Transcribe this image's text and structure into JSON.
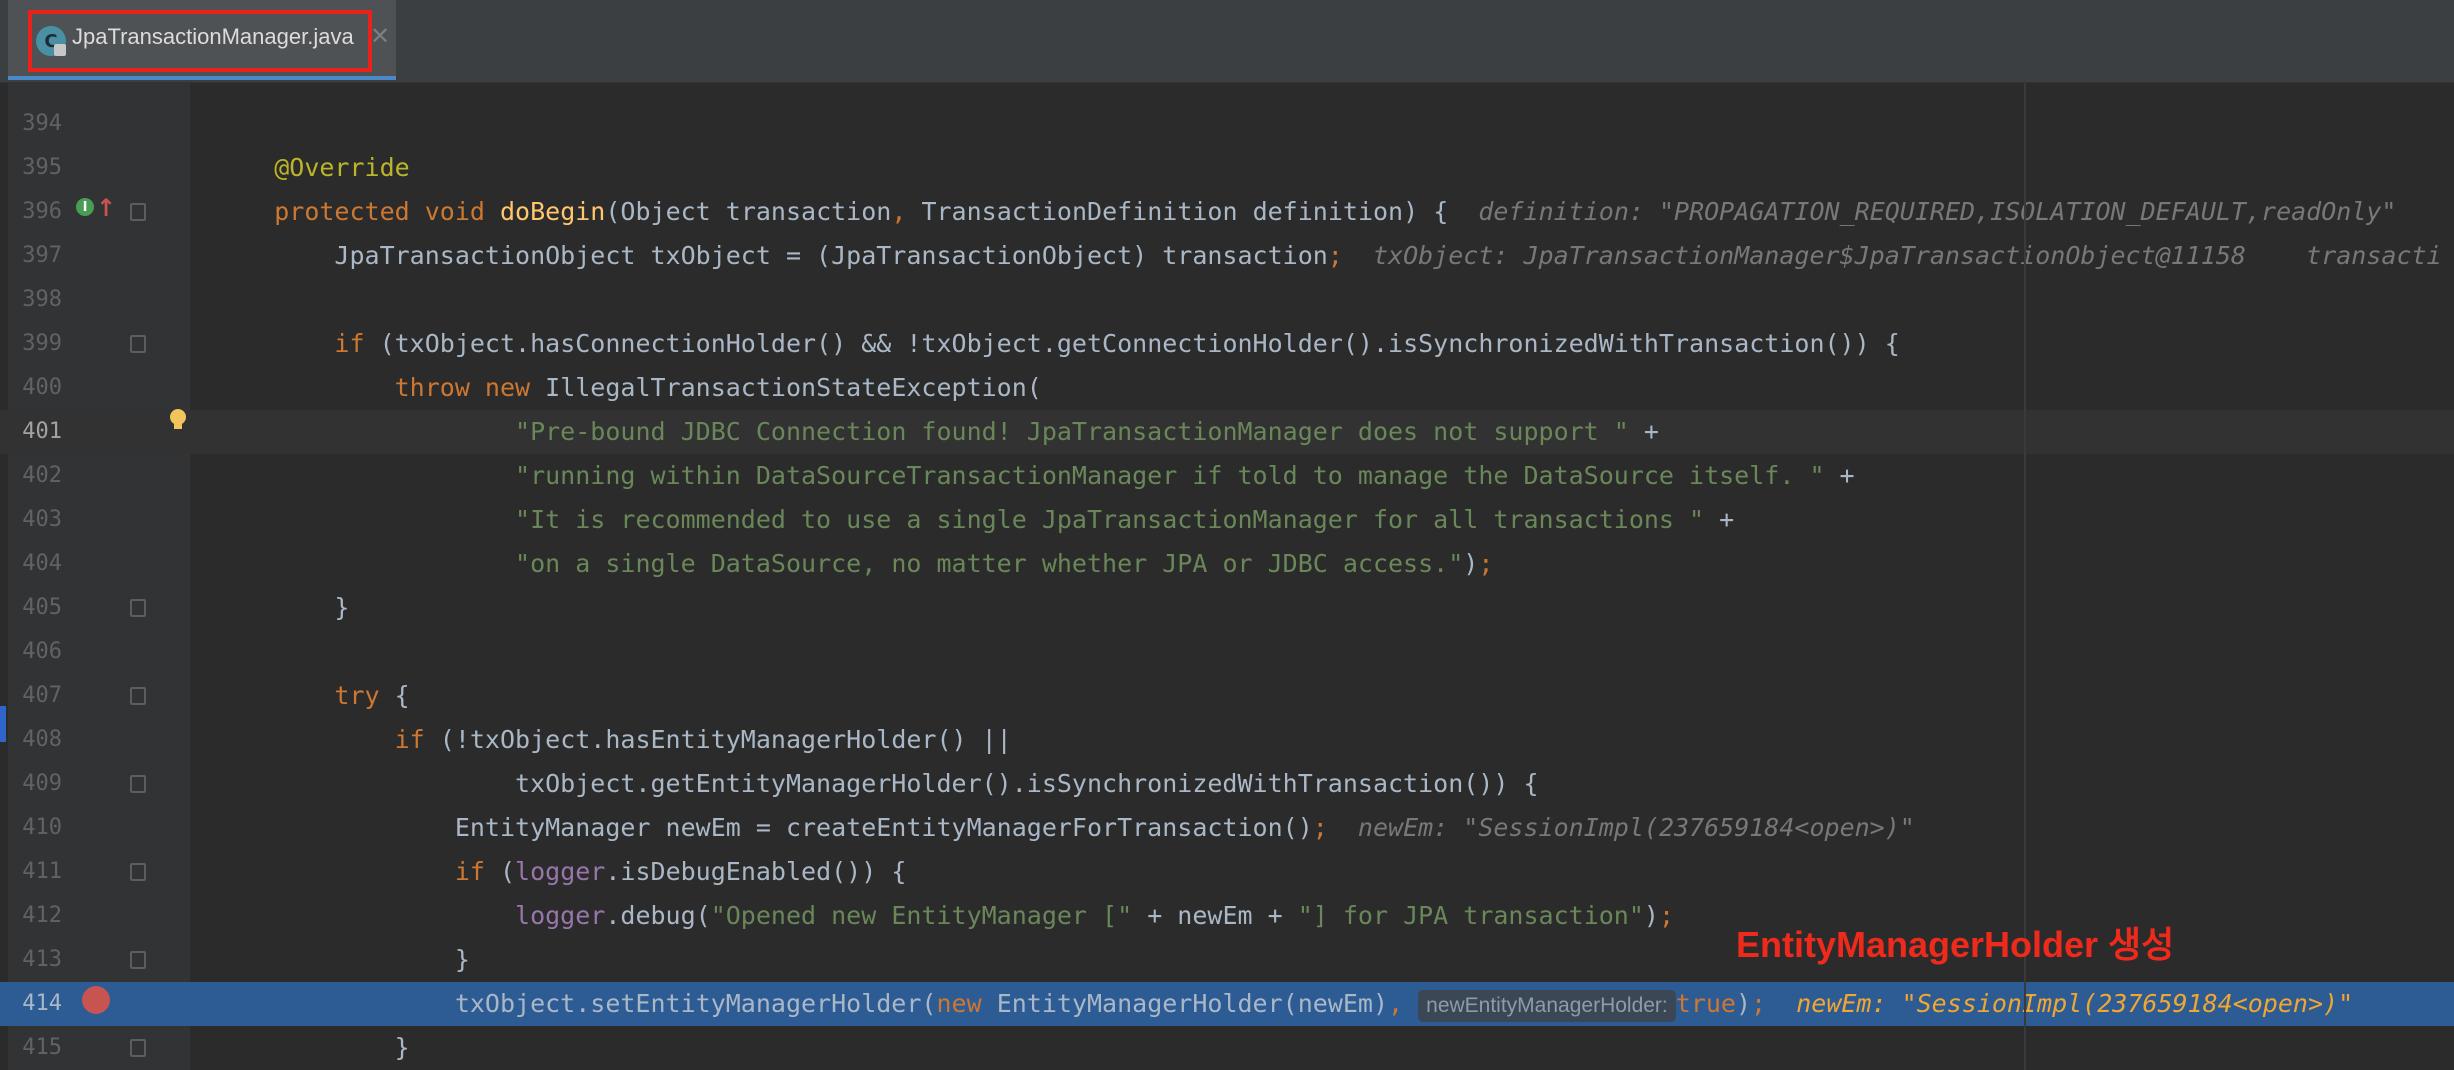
{
  "tab": {
    "icon_letter": "C",
    "filename": "JpaTransactionManager.java",
    "close_glyph": "✕"
  },
  "annotation": "EntityManagerHolder 생성",
  "colors": {
    "keyword": "#cc7832",
    "string": "#6a8759",
    "annotation": "#bbb529",
    "method": "#ffc66d",
    "breakpoint_line": "#2d5b94",
    "callout": "#ee2a1c"
  },
  "lines": [
    {
      "n": "394",
      "parts": []
    },
    {
      "n": "395",
      "parts": [
        {
          "t": "    "
        },
        {
          "t": "@Override",
          "c": "ann"
        }
      ]
    },
    {
      "n": "396",
      "parts": [
        {
          "t": "    "
        },
        {
          "t": "protected void ",
          "c": "kw"
        },
        {
          "t": "doBegin",
          "c": "fn"
        },
        {
          "t": "(Object transaction"
        },
        {
          "t": ", ",
          "c": "kw"
        },
        {
          "t": "TransactionDefinition definition) {  "
        },
        {
          "t": "definition: \"PROPAGATION_REQUIRED,ISOLATION_DEFAULT,readOnly\"",
          "c": "hint"
        }
      ]
    },
    {
      "n": "397",
      "parts": [
        {
          "t": "        JpaTransactionObject txObject = (JpaTransactionObject) transaction"
        },
        {
          "t": ";",
          "c": "kw"
        },
        {
          "t": "  "
        },
        {
          "t": "txObject: JpaTransactionManager$JpaTransactionObject@11158    transacti",
          "c": "hint"
        }
      ]
    },
    {
      "n": "398",
      "parts": []
    },
    {
      "n": "399",
      "parts": [
        {
          "t": "        "
        },
        {
          "t": "if ",
          "c": "kw"
        },
        {
          "t": "(txObject.hasConnectionHolder() && !txObject.getConnectionHolder().isSynchronizedWithTransaction()) {"
        }
      ]
    },
    {
      "n": "400",
      "parts": [
        {
          "t": "            "
        },
        {
          "t": "throw new ",
          "c": "kw"
        },
        {
          "t": "IllegalTransactionStateException("
        }
      ]
    },
    {
      "n": "401",
      "current": true,
      "parts": [
        {
          "t": "                    "
        },
        {
          "t": "\"Pre-bound JDBC Connection found! JpaTransactionManager does not support \"",
          "c": "str"
        },
        {
          "t": " +"
        }
      ]
    },
    {
      "n": "402",
      "parts": [
        {
          "t": "                    "
        },
        {
          "t": "\"running within DataSourceTransactionManager if told to manage the DataSource itself. \"",
          "c": "str"
        },
        {
          "t": " +"
        }
      ]
    },
    {
      "n": "403",
      "parts": [
        {
          "t": "                    "
        },
        {
          "t": "\"It is recommended to use a single JpaTransactionManager for all transactions \"",
          "c": "str"
        },
        {
          "t": " +"
        }
      ]
    },
    {
      "n": "404",
      "parts": [
        {
          "t": "                    "
        },
        {
          "t": "\"on a single DataSource, no matter whether JPA or JDBC access.\"",
          "c": "str"
        },
        {
          "t": ")"
        },
        {
          "t": ";",
          "c": "kw"
        }
      ]
    },
    {
      "n": "405",
      "parts": [
        {
          "t": "        }"
        }
      ]
    },
    {
      "n": "406",
      "parts": []
    },
    {
      "n": "407",
      "parts": [
        {
          "t": "        "
        },
        {
          "t": "try ",
          "c": "kw"
        },
        {
          "t": "{"
        }
      ]
    },
    {
      "n": "408",
      "parts": [
        {
          "t": "            "
        },
        {
          "t": "if ",
          "c": "kw"
        },
        {
          "t": "(!txObject.hasEntityManagerHolder() ||"
        }
      ]
    },
    {
      "n": "409",
      "parts": [
        {
          "t": "                    txObject.getEntityManagerHolder().isSynchronizedWithTransaction()) {"
        }
      ]
    },
    {
      "n": "410",
      "parts": [
        {
          "t": "                EntityManager newEm = createEntityManagerForTransaction()"
        },
        {
          "t": ";",
          "c": "kw"
        },
        {
          "t": "  "
        },
        {
          "t": "newEm: \"SessionImpl(237659184<open>)\"",
          "c": "hint"
        }
      ]
    },
    {
      "n": "411",
      "parts": [
        {
          "t": "                "
        },
        {
          "t": "if ",
          "c": "kw"
        },
        {
          "t": "("
        },
        {
          "t": "logger",
          "c": "field"
        },
        {
          "t": ".isDebugEnabled()) {"
        }
      ]
    },
    {
      "n": "412",
      "parts": [
        {
          "t": "                    "
        },
        {
          "t": "logger",
          "c": "field"
        },
        {
          "t": ".debug("
        },
        {
          "t": "\"Opened new EntityManager [\"",
          "c": "str"
        },
        {
          "t": " + newEm + "
        },
        {
          "t": "\"] for JPA transaction\"",
          "c": "str"
        },
        {
          "t": ")"
        },
        {
          "t": ";",
          "c": "kw"
        }
      ]
    },
    {
      "n": "413",
      "parts": [
        {
          "t": "                }"
        }
      ]
    },
    {
      "n": "414",
      "bp": true,
      "parts": [
        {
          "t": "                txObject.setEntityManagerHolder("
        },
        {
          "t": "new ",
          "c": "kw"
        },
        {
          "t": "EntityManagerHolder(newEm)"
        },
        {
          "t": ", ",
          "c": "kw"
        },
        {
          "t": "newEntityManagerHolder:",
          "c": "inlay"
        },
        {
          "t": "true",
          "c": "kw"
        },
        {
          "t": ")"
        },
        {
          "t": ";",
          "c": "kw"
        },
        {
          "t": "  "
        },
        {
          "t": "newEm: \"SessionImpl(237659184<open>)\"",
          "c": "hint-bp"
        }
      ]
    },
    {
      "n": "415",
      "parts": [
        {
          "t": "            }"
        }
      ]
    }
  ]
}
